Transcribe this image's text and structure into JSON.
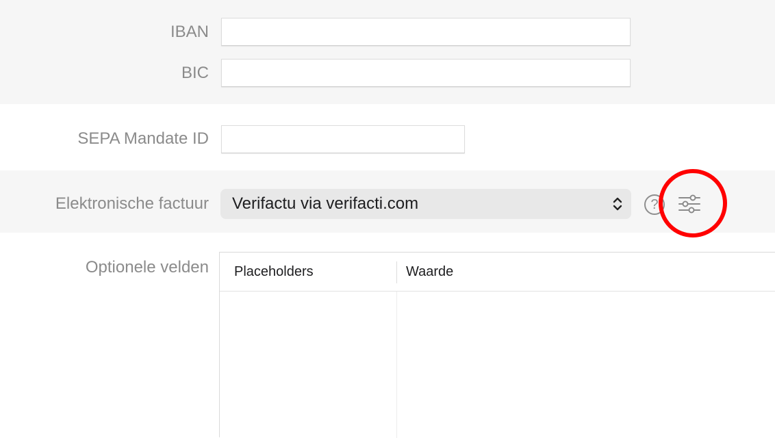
{
  "form": {
    "iban": {
      "label": "IBAN",
      "value": ""
    },
    "bic": {
      "label": "BIC",
      "value": ""
    },
    "sepa": {
      "label": "SEPA Mandate ID",
      "value": ""
    },
    "efactuur": {
      "label": "Elektronische factuur",
      "selected": "Verifactu via verifacti.com",
      "help_glyph": "?",
      "settings_icon": "sliders-icon"
    },
    "optional": {
      "label": "Optionele velden",
      "columns": [
        "Placeholders",
        "Waarde"
      ],
      "rows": []
    }
  },
  "annotation": {
    "highlight_color": "#ff0000"
  }
}
